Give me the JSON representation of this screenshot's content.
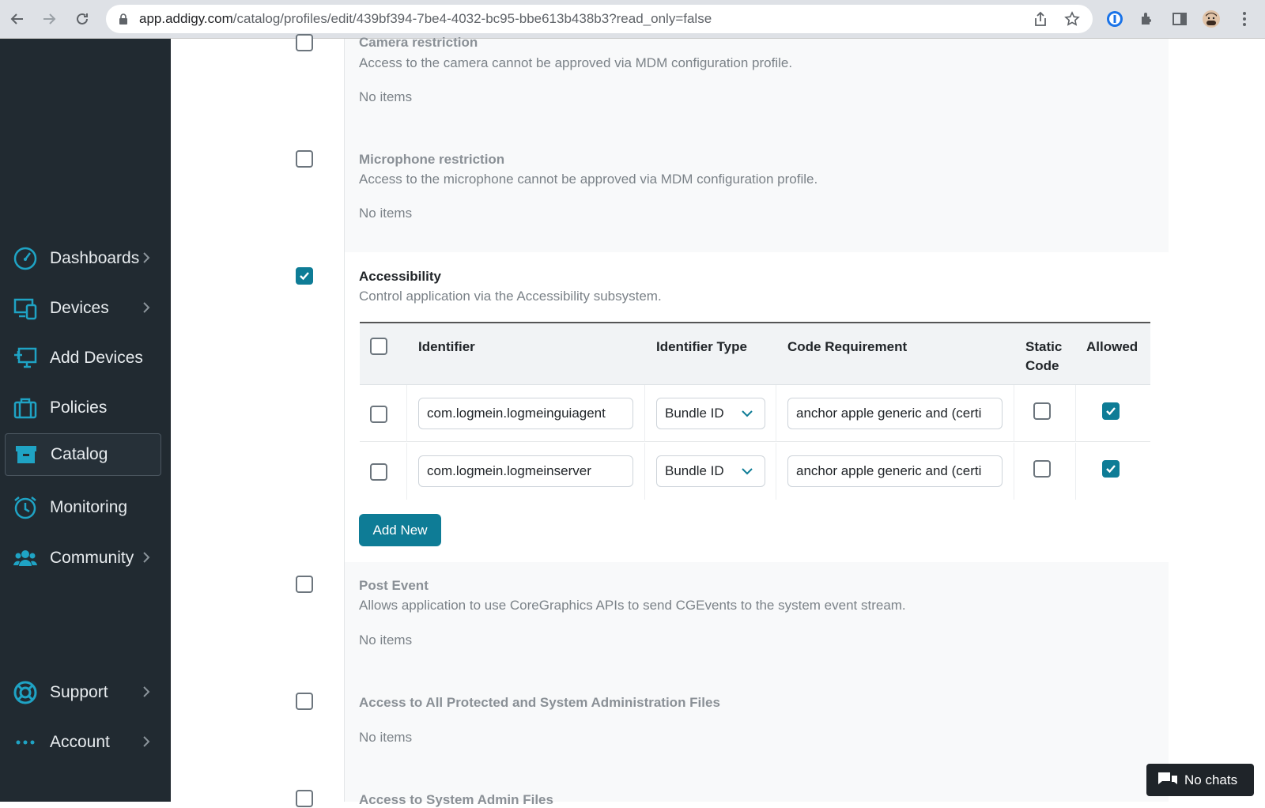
{
  "browser": {
    "url_host": "app.addigy.com",
    "url_path": "/catalog/profiles/edit/439bf394-7be4-4032-bc95-bbe613b438b3?read_only=false"
  },
  "sidebar": {
    "items": [
      {
        "label": "Dashboards",
        "icon": "gauge-icon",
        "has_chevron": true
      },
      {
        "label": "Devices",
        "icon": "devices-icon",
        "has_chevron": true
      },
      {
        "label": "Add Devices",
        "icon": "add-device-icon",
        "has_chevron": false
      },
      {
        "label": "Policies",
        "icon": "briefcase-icon",
        "has_chevron": false
      },
      {
        "label": "Catalog",
        "icon": "archive-icon",
        "has_chevron": false,
        "active": true
      },
      {
        "label": "Monitoring",
        "icon": "alarm-clock-icon",
        "has_chevron": false
      },
      {
        "label": "Community",
        "icon": "users-icon",
        "has_chevron": true
      },
      {
        "label": "Support",
        "icon": "lifebuoy-icon",
        "has_chevron": true
      },
      {
        "label": "Account",
        "icon": "more-dots-icon",
        "has_chevron": true
      }
    ]
  },
  "sections": {
    "camera": {
      "title": "Camera restriction",
      "desc": "Access to the camera cannot be approved via MDM configuration profile.",
      "empty": "No items",
      "checked": false
    },
    "microphone": {
      "title": "Microphone restriction",
      "desc": "Access to the microphone cannot be approved via MDM configuration profile.",
      "empty": "No items",
      "checked": false
    },
    "accessibility": {
      "title": "Accessibility",
      "desc": "Control application via the Accessibility subsystem.",
      "checked": true
    },
    "post_event": {
      "title": "Post Event",
      "desc": "Allows application to use CoreGraphics APIs to send CGEvents to the system event stream.",
      "empty": "No items",
      "checked": false
    },
    "all_protected": {
      "title": "Access to All Protected and System Administration Files",
      "empty": "No items",
      "checked": false
    },
    "sys_admin": {
      "title": "Access to System Admin Files",
      "checked": false
    }
  },
  "table": {
    "headers": {
      "identifier": "Identifier",
      "identifier_type": "Identifier Type",
      "code_requirement": "Code Requirement",
      "static_code_1": "Static",
      "static_code_2": "Code",
      "allowed": "Allowed"
    },
    "rows": [
      {
        "identifier": "com.logmein.logmeinguiagent",
        "identifier_type": "Bundle ID",
        "code_requirement": "anchor apple generic and (certi",
        "static_code": false,
        "allowed": true
      },
      {
        "identifier": "com.logmein.logmeinserver",
        "identifier_type": "Bundle ID",
        "code_requirement": "anchor apple generic and (certi",
        "static_code": false,
        "allowed": true
      }
    ]
  },
  "add_button": "Add New",
  "chat": {
    "label": "No chats"
  },
  "colors": {
    "accent": "#0e7c96",
    "sidebar_bg": "#212a31",
    "icon": "#1fa3c4"
  }
}
